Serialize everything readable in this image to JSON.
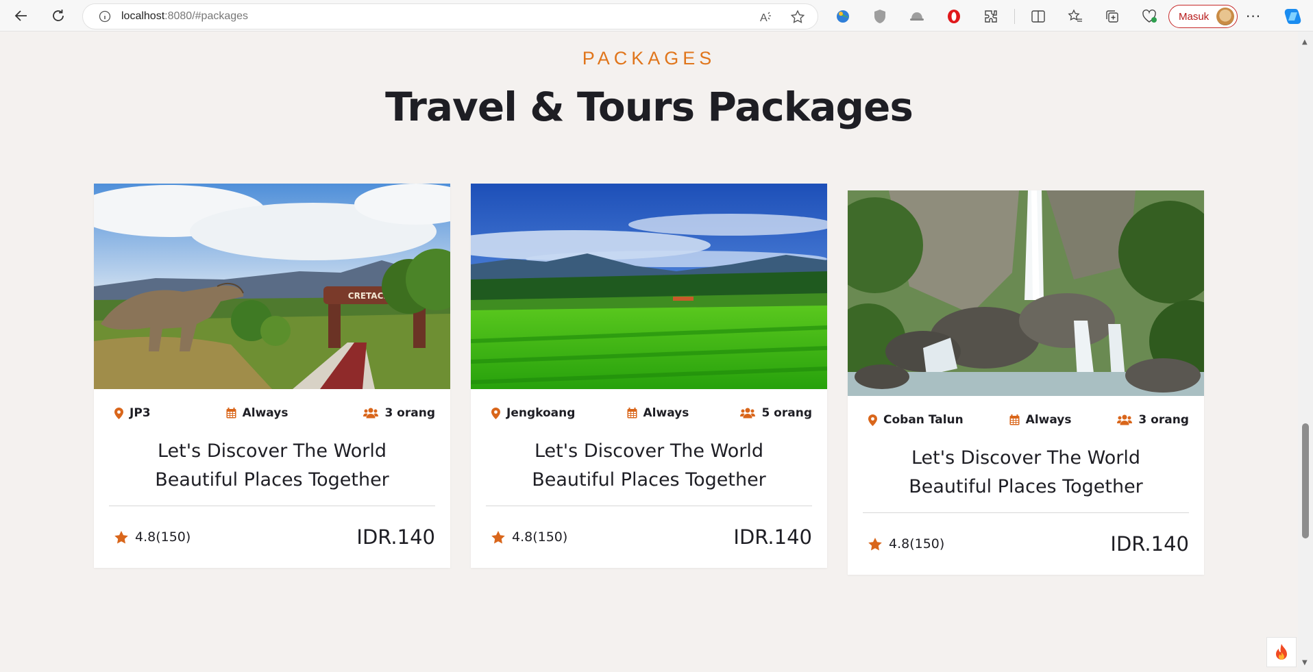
{
  "browser": {
    "url_host": "localhost",
    "url_rest": ":8080/#packages",
    "signin_label": "Masuk"
  },
  "section": {
    "tag": "PACKAGES",
    "title": "Travel & Tours Packages"
  },
  "packages": [
    {
      "location": "JP3",
      "schedule": "Always",
      "people": "3 orang",
      "title": "Let's Discover The World Beautiful Places Together",
      "rating": "4.8(150)",
      "price": "IDR.140",
      "image": "dinosaur-park-photo"
    },
    {
      "location": "Jengkoang",
      "schedule": "Always",
      "people": "5 orang",
      "title": "Let's Discover The World Beautiful Places Together",
      "rating": "4.8(150)",
      "price": "IDR.140",
      "image": "green-field-mountain-photo"
    },
    {
      "location": "Coban Talun",
      "schedule": "Always",
      "people": "3 orang",
      "title": "Let's Discover The World Beautiful Places Together",
      "rating": "4.8(150)",
      "price": "IDR.140",
      "image": "waterfall-photo"
    }
  ],
  "colors": {
    "accent": "#e0751b",
    "icon": "#d9661b",
    "text": "#1e1e24",
    "background": "#f4f1ef"
  }
}
